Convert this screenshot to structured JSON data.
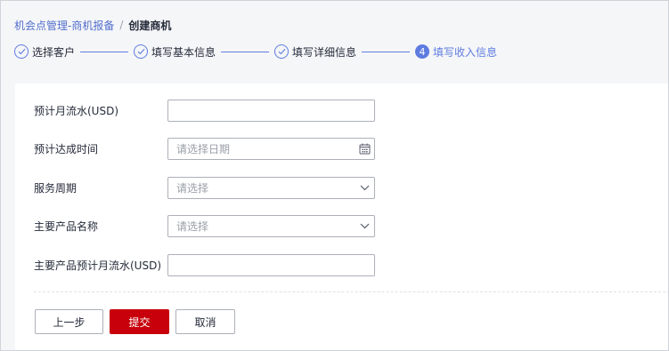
{
  "breadcrumb": {
    "parent": "机会点管理-商机报备",
    "separator": "/",
    "current": "创建商机"
  },
  "steps": [
    {
      "number": "",
      "label": "选择客户",
      "state": "done",
      "icon": "check-icon"
    },
    {
      "number": "",
      "label": "填写基本信息",
      "state": "done",
      "icon": "check-icon"
    },
    {
      "number": "",
      "label": "填写详细信息",
      "state": "done",
      "icon": "check-icon"
    },
    {
      "number": "4",
      "label": "填写收入信息",
      "state": "active",
      "icon": ""
    }
  ],
  "form": {
    "monthly_flow": {
      "label": "预计月流水(USD)",
      "value": ""
    },
    "reach_time": {
      "label": "预计达成时间",
      "placeholder": "请选择日期",
      "icon": "calendar-icon"
    },
    "service_period": {
      "label": "服务周期",
      "placeholder": "请选择",
      "icon": "chevron-down-icon"
    },
    "main_product": {
      "label": "主要产品名称",
      "placeholder": "请选择",
      "icon": "chevron-down-icon"
    },
    "product_monthly_flow": {
      "label": "主要产品预计月流水(USD)",
      "value": ""
    }
  },
  "actions": {
    "prev": "上一步",
    "submit": "提交",
    "cancel": "取消"
  },
  "colors": {
    "accent": "#5e7ce0",
    "primary_button": "#c7000b",
    "page_background": "#f5f6f8"
  }
}
